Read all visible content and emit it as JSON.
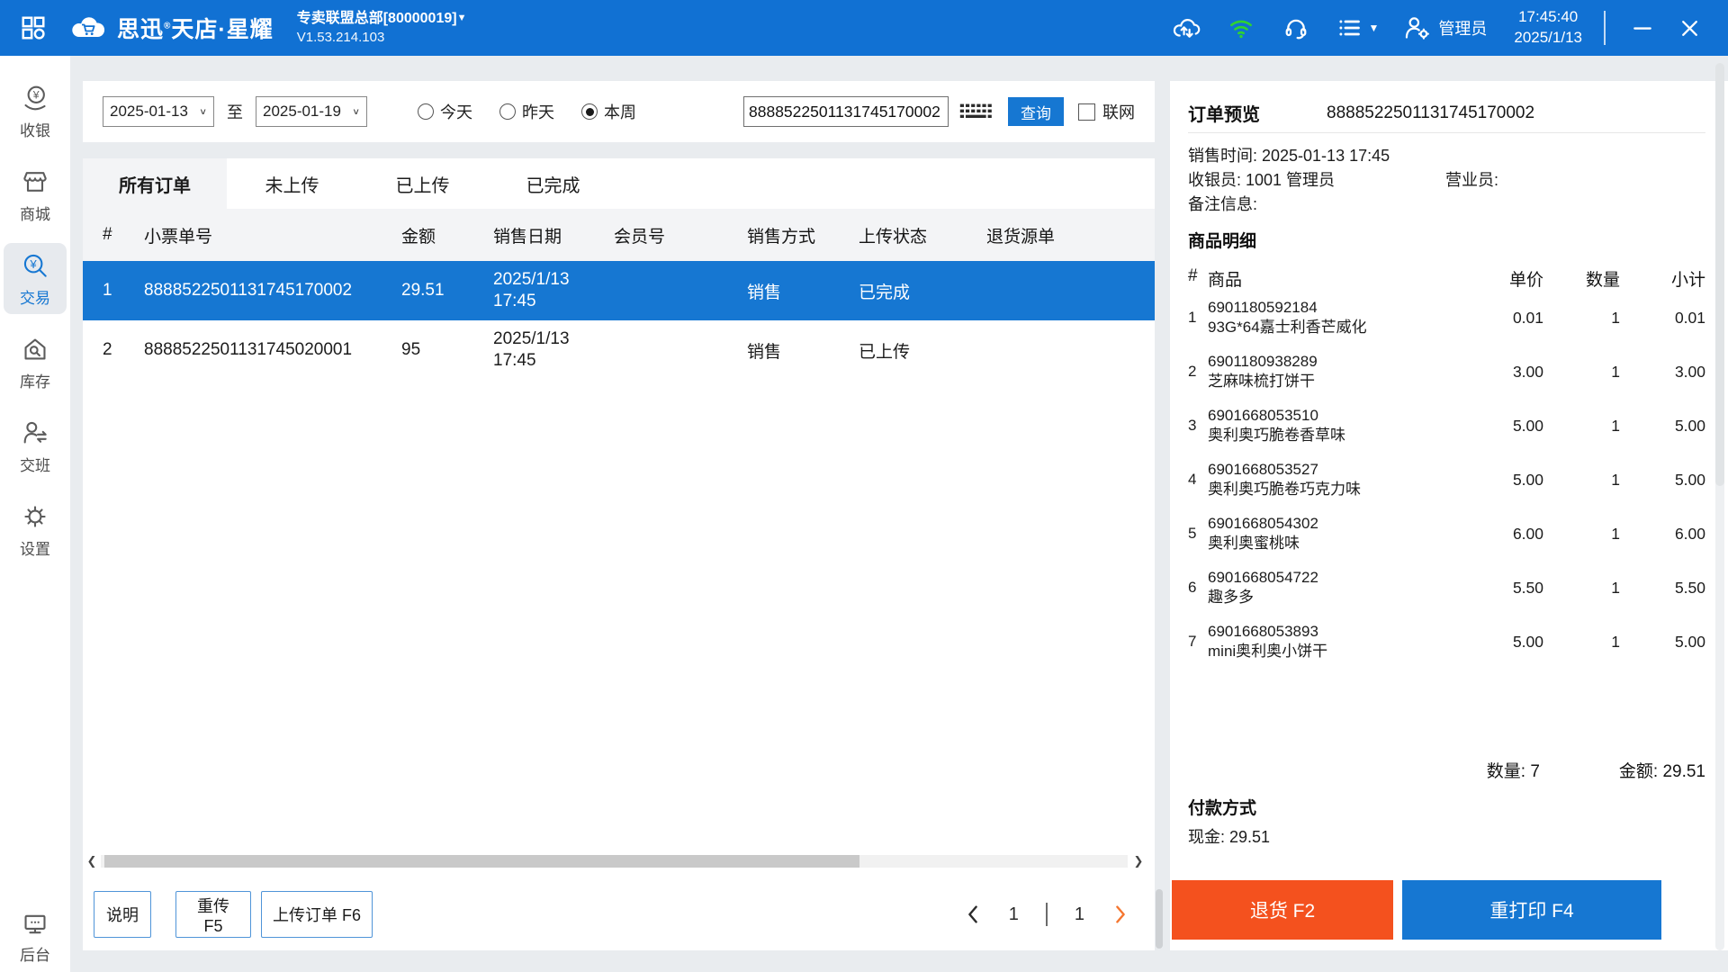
{
  "colors": {
    "topbar": "#1171d3",
    "primary": "#1677d2",
    "row_selected": "#1677d2",
    "refund_button": "#f4511e",
    "wifi_green": "#2fd32f",
    "pager_next_arrow": "#f5762f"
  },
  "topbar": {
    "brand_left": "思迅",
    "brand_reg": "®",
    "brand_right": "天店·星耀",
    "store": "专卖联盟总部[80000019]",
    "store_caret": "▼",
    "version": "V1.53.214.103",
    "user": "管理员",
    "list_caret": "▼",
    "time": "17:45:40",
    "date": "2025/1/13"
  },
  "sidebar": {
    "items": [
      "收银",
      "商城",
      "交易",
      "库存",
      "交班",
      "设置"
    ],
    "selected": "交易",
    "bottom": "后台"
  },
  "filter": {
    "date_from": "2025-01-13",
    "to_label": "至",
    "date_to": "2025-01-19",
    "radios": [
      "今天",
      "昨天",
      "本周"
    ],
    "radio_selected": "本周",
    "search_value": "8888522501131745170002",
    "query_label": "查询",
    "online_label": "联网"
  },
  "tabs": [
    "所有订单",
    "未上传",
    "已上传",
    "已完成"
  ],
  "orders": {
    "columns": [
      "#",
      "小票单号",
      "金额",
      "销售日期",
      "会员号",
      "销售方式",
      "上传状态",
      "退货源单"
    ],
    "rows": [
      {
        "idx": "1",
        "no": "8888522501131745170002",
        "amount": "29.51",
        "date": "2025/1/13",
        "time": "17:45",
        "member": "",
        "method": "销售",
        "status": "已完成",
        "source": ""
      },
      {
        "idx": "2",
        "no": "8888522501131745020001",
        "amount": "95",
        "date": "2025/1/13",
        "time": "17:45",
        "member": "",
        "method": "销售",
        "status": "已上传",
        "source": ""
      }
    ]
  },
  "footer": {
    "help": "说明",
    "retry": "重传 F5",
    "upload": "上传订单 F6",
    "page_current": "1",
    "page_total": "1"
  },
  "preview": {
    "title": "订单预览",
    "order_no": "8888522501131745170002",
    "sale_time_line": "销售时间: 2025-01-13 17:45",
    "cashier_line": "收银员: 1001 管理员",
    "clerk_label": "营业员:",
    "remark_label": "备注信息:",
    "detail_title": "商品明细",
    "columns": [
      "#",
      "商品",
      "单价",
      "数量",
      "小计"
    ],
    "items": [
      {
        "idx": "1",
        "code": "6901180592184",
        "name": "93G*64嘉士利香芒威化",
        "price": "0.01",
        "qty": "1",
        "sub": "0.01"
      },
      {
        "idx": "2",
        "code": "6901180938289",
        "name": "芝麻味梳打饼干",
        "price": "3.00",
        "qty": "1",
        "sub": "3.00"
      },
      {
        "idx": "3",
        "code": "6901668053510",
        "name": "奥利奥巧脆卷香草味",
        "price": "5.00",
        "qty": "1",
        "sub": "5.00"
      },
      {
        "idx": "4",
        "code": "6901668053527",
        "name": "奥利奥巧脆卷巧克力味",
        "price": "5.00",
        "qty": "1",
        "sub": "5.00"
      },
      {
        "idx": "5",
        "code": "6901668054302",
        "name": "奥利奥蜜桃味",
        "price": "6.00",
        "qty": "1",
        "sub": "6.00"
      },
      {
        "idx": "6",
        "code": "6901668054722",
        "name": "趣多多",
        "price": "5.50",
        "qty": "1",
        "sub": "5.50"
      },
      {
        "idx": "7",
        "code": "6901668053893",
        "name": "mini奥利奥小饼干",
        "price": "5.00",
        "qty": "1",
        "sub": "5.00"
      }
    ],
    "qty_total_line": "数量: 7",
    "amount_total_line": "金额: 29.51",
    "payment_title": "付款方式",
    "payment_line": "现金: 29.51",
    "refund_button": "退货 F2",
    "reprint_button": "重打印 F4"
  }
}
